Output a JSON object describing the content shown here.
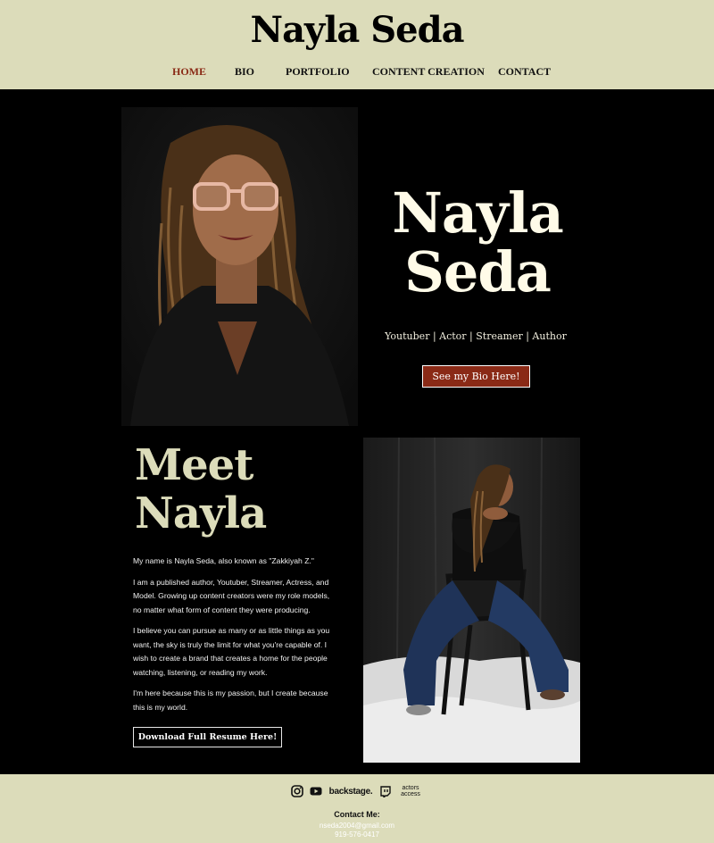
{
  "site": {
    "brand": "Nayla  Seda"
  },
  "nav": {
    "home": "HOME",
    "bio": "BIO",
    "portfolio": "PORTFOLIO",
    "content_creation": "CONTENT CREATION",
    "contact": "CONTACT"
  },
  "hero": {
    "name_line1": "Nayla",
    "name_line2": "Seda",
    "subtitle": "Youtuber | Actor | Streamer | Author",
    "cta_label": "See my Bio Here!"
  },
  "meet": {
    "heading_line1": "Meet",
    "heading_line2": "Nayla",
    "paragraphs": [
      "My name is Nayla Seda, also known as \"Zakkiyah Z.\"",
      "I am a published author, Youtuber, Streamer, Actress, and Model. Growing up content creators were my role models, no matter what form of content they were producing.",
      "I believe you can pursue as many or as little things as you want, the sky is truly the limit for what you're capable of. I wish to create a brand that creates a home for the people watching, listening, or reading my work.",
      "I'm here because this is my passion, but I create because this is my world."
    ],
    "resume_label": "Download Full Resume Here!"
  },
  "footer": {
    "social": {
      "instagram": "instagram-icon",
      "youtube": "youtube-icon",
      "backstage": "backstage.",
      "twitch": "twitch-icon",
      "actors_access_line1": "actors",
      "actors_access_line2": "access"
    },
    "contact_label": "Contact Me:",
    "email": "nseda2004@gmail.com",
    "phone": "919-576-0417"
  },
  "colors": {
    "cream": "#dcdcba",
    "accent": "#8a2a16",
    "background": "#000000"
  }
}
